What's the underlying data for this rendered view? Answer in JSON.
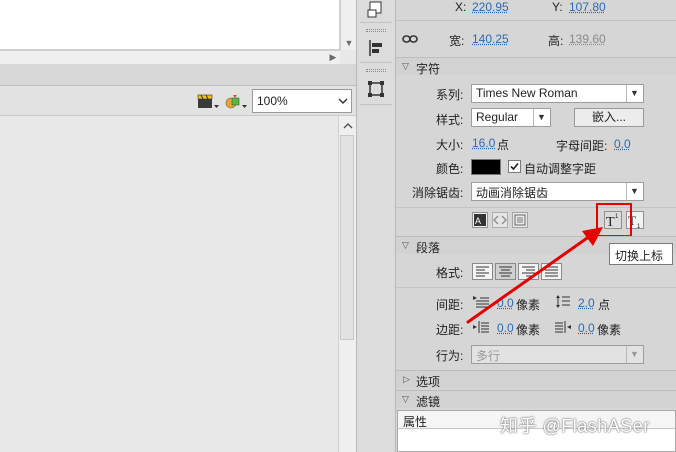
{
  "stage": {
    "zoom_value": "100%"
  },
  "position": {
    "x_label": "X:",
    "x_value": "220.95",
    "y_label": "Y:",
    "y_value": "107.80",
    "width_label": "宽:",
    "width_value": "140.25",
    "height_label": "高:",
    "height_value": "139.60"
  },
  "character": {
    "section_title": "字符",
    "family_label": "系列:",
    "family_value": "Times New Roman",
    "style_label": "样式:",
    "style_value": "Regular",
    "embed_button": "嵌入...",
    "size_label": "大小:",
    "size_value": "16.0",
    "size_unit": "点",
    "letter_spacing_label": "字母间距:",
    "letter_spacing_value": "0.0",
    "color_label": "颜色:",
    "color_swatch": "#000000",
    "auto_kern_label": "自动调整字距",
    "auto_kern_checked": true,
    "antialias_label": "消除锯齿:",
    "antialias_value": "动画消除锯齿"
  },
  "paragraph": {
    "section_title": "段落",
    "format_label": "格式:",
    "spacing_label": "间距:",
    "indent_value": "0.0",
    "indent_unit": "像素",
    "line_spacing_value": "2.0",
    "line_spacing_unit": "点",
    "margin_label": "边距:",
    "left_margin_value": "0.0",
    "left_margin_unit": "像素",
    "right_margin_value": "0.0",
    "right_margin_unit": "像素",
    "behavior_label": "行为:",
    "behavior_value": "多行"
  },
  "options": {
    "section_title": "选项"
  },
  "filters": {
    "section_title": "滤镜",
    "column_header": "属性"
  },
  "tooltip": {
    "text": "切换上标"
  },
  "watermark": {
    "text": "知乎 @FlashASer"
  },
  "colors": {
    "highlight": "#e60000",
    "link_value": "#2a6ab5"
  }
}
